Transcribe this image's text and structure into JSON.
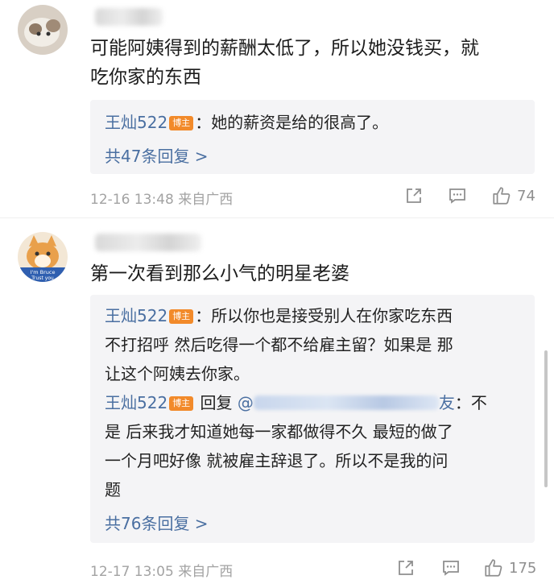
{
  "comments": [
    {
      "text_lines": [
        "可能阿姨得到的薪酬太低了，所以她没钱买，就",
        "吃你家的东西"
      ],
      "replies": [
        {
          "author": "王灿522",
          "badge": "博主",
          "sep": "：",
          "text": "她的薪资是给的很高了。"
        }
      ],
      "more": "共47条回复 >",
      "date": "12-16 13:48",
      "source": "来自广西",
      "likes": "74"
    },
    {
      "avatar_text": "I'm Bruce\nTrust you",
      "text_lines": [
        "第一次看到那么小气的明星老婆"
      ],
      "replies": [
        {
          "author": "王灿522",
          "badge": "博主",
          "sep": "：",
          "lines": [
            "所以你也是接受别人在你家吃东西",
            "不打招呼 然后吃得一个都不给雇主留？如果是 那",
            "让这个阿姨去你家。"
          ]
        },
        {
          "author": "王灿522",
          "badge": "博主",
          "reply_word": "回复",
          "at": "@",
          "at_tail": "友",
          "lines": [
            "：不",
            "是 后来我才知道她每一家都做得不久 最短的做了",
            "一个月吧好像 就被雇主辞退了。所以不是我的问",
            "题"
          ]
        }
      ],
      "more": "共76条回复 >",
      "date": "12-17 13:05",
      "source": "来自广西",
      "likes": "175"
    }
  ]
}
